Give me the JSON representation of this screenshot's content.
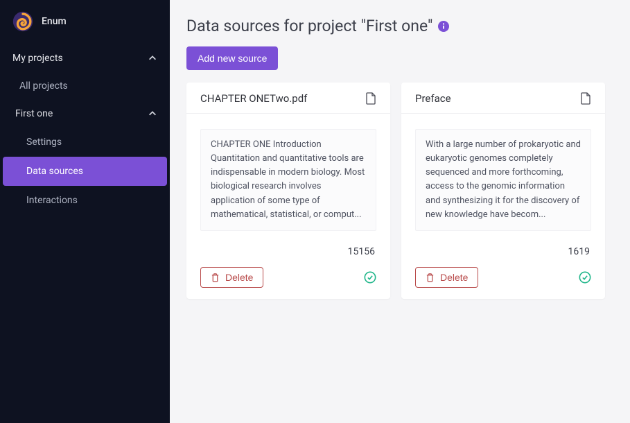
{
  "brand": {
    "name": "Enum"
  },
  "sidebar": {
    "group_label": "My projects",
    "all_projects": "All projects",
    "project_label": "First one",
    "subitems": {
      "settings": "Settings",
      "data_sources": "Data sources",
      "interactions": "Interactions"
    }
  },
  "page": {
    "title": "Data sources for project \"First one\"",
    "add_button": "Add new source"
  },
  "cards": [
    {
      "title": "CHAPTER ONETwo.pdf",
      "snippet": "CHAPTER ONE Introduction Quantitation and quantitative tools are indispensable in modern biology. Most biological research involves application of some type of mathematical, statistical, or comput...",
      "count": "15156",
      "delete_label": "Delete"
    },
    {
      "title": "Preface",
      "snippet": "With a large number of prokaryotic and eukaryotic genomes completely sequenced and more forthcoming, access to the genomic information and synthesizing it for the discovery of new knowledge have becom...",
      "count": "1619",
      "delete_label": "Delete"
    }
  ]
}
